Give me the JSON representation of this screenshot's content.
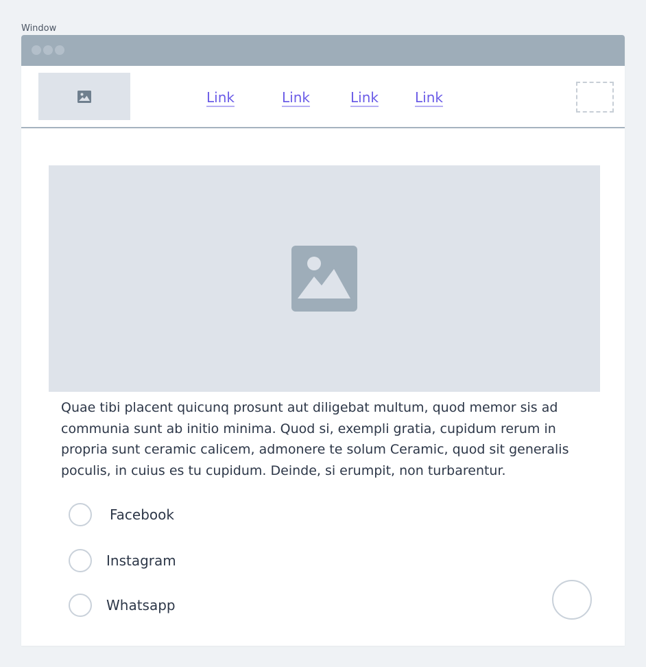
{
  "window": {
    "label": "Window"
  },
  "navbar": {
    "links": [
      "Link",
      "Link",
      "Link",
      "Link"
    ]
  },
  "content": {
    "paragraph": "Quae tibi placent quicunq prosunt aut diligebat multum, quod memor sis ad communia sunt ab initio minima. Quod si, exempli gratia, cupidum rerum in propria sunt ceramic calicem, admonere te solum Ceramic, quod sit generalis poculis, in cuius es tu cupidum. Deinde, si erumpit, non turbarentur."
  },
  "options": [
    {
      "label": "Facebook",
      "selected": false
    },
    {
      "label": "Instagram",
      "selected": false
    },
    {
      "label": "Whatsapp",
      "selected": false
    }
  ],
  "icons": {
    "logo": "image-icon",
    "hero": "image-icon"
  },
  "colors": {
    "link": "#6b5ce7",
    "titlebar": "#9eadb9",
    "placeholder_bg": "#dee3ea",
    "page_bg": "#eff2f5"
  }
}
